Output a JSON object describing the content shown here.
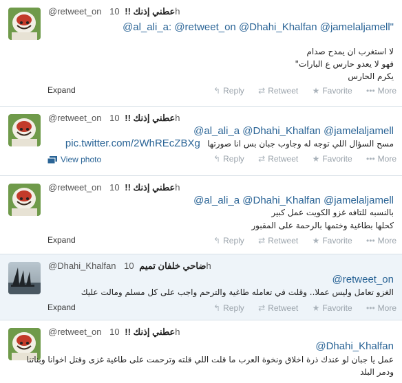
{
  "actions": {
    "reply": "Reply",
    "retweet": "Retweet",
    "favorite": "Favorite",
    "more": "More",
    "expand": "Expand",
    "view_photo": "View photo"
  },
  "icons": {
    "reply": "reply-arrow-icon",
    "retweet": "retweet-arrows-icon",
    "favorite": "star-icon",
    "more": "ellipsis-icon",
    "photo": "image-icon"
  },
  "colors": {
    "link": "#2a6496",
    "muted": "#9aa3ab",
    "alt_bg": "#eef4f9"
  },
  "tweets": [
    {
      "handle": "@retweet_on",
      "name": "عطني إذنك !!",
      "time": "10h",
      "line1": "@al_ali_a: @retweet_on @Dhahi_Khalfan @jamelaljamell\"",
      "body": [
        "لا استغرب ان يمدح صدام",
        "فهو لا يعدو حارس ع البارات\"",
        "يكرم الحارس"
      ]
    },
    {
      "handle": "@retweet_on",
      "name": "عطني إذنك !!",
      "time": "10h",
      "line1": "@al_ali_a @Dhahi_Khalfan @jamelaljamell",
      "body_text": "مسح السؤال اللي توجه له وجاوب جبان بس انا صورتها",
      "link": "pic.twitter.com/2WhREcZBXg"
    },
    {
      "handle": "@retweet_on",
      "name": "عطني إذنك !!",
      "time": "10h",
      "line1": "@al_ali_a @Dhahi_Khalfan @jamelaljamell",
      "body": [
        "بالنسبه للتافه غزو الكويت عمل كبير",
        "كحلها بطاغية وختمها بالرحمة على المقبور"
      ]
    },
    {
      "handle": "@Dhahi_Khalfan",
      "name": "ضاحي خلفان تميم",
      "time": "10h",
      "line1": "@retweet_on",
      "body": [
        "الغزو تعامل وليس عملا.. وقلت في تعامله طاغية والترحم واجب على كل مسلم ومالت عليك"
      ]
    },
    {
      "handle": "@retweet_on",
      "name": "عطني إذنك !!",
      "time": "10h",
      "line1": "@Dhahi_Khalfan",
      "body": [
        "عمل يا جبان لو عندك ذرة اخلاق ونخوة العرب ما قلت اللي قلته وترحمت على طاغية غزى وقتل اخوانا وبناتنا",
        "ودمر البلد"
      ]
    }
  ]
}
